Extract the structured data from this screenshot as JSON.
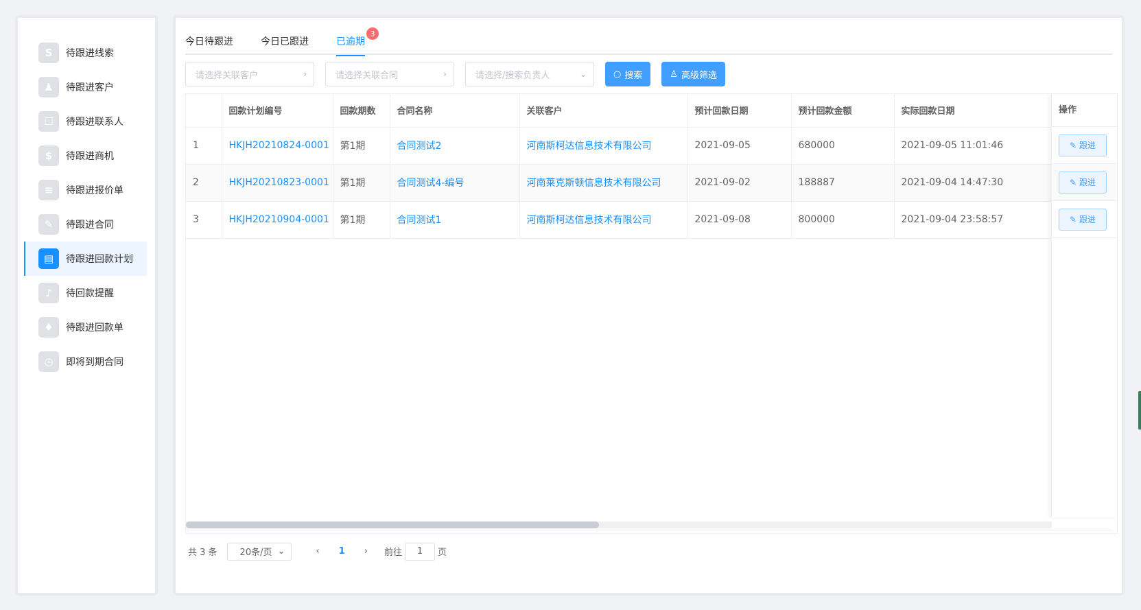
{
  "sidebar": {
    "items": [
      {
        "label": "待跟进线索",
        "icon": "link-icon",
        "glyph": "S"
      },
      {
        "label": "待跟进客户",
        "icon": "users-icon",
        "glyph": "♟"
      },
      {
        "label": "待跟进联系人",
        "icon": "contact-icon",
        "glyph": "☐"
      },
      {
        "label": "待跟进商机",
        "icon": "dollar-icon",
        "glyph": "$"
      },
      {
        "label": "待跟进报价单",
        "icon": "quote-icon",
        "glyph": "≡"
      },
      {
        "label": "待跟进合同",
        "icon": "contract-icon",
        "glyph": "✎"
      },
      {
        "label": "待跟进回款计划",
        "icon": "payment-plan-icon",
        "glyph": "▤",
        "active": true
      },
      {
        "label": "待回款提醒",
        "icon": "bell-icon",
        "glyph": "♪"
      },
      {
        "label": "待跟进回款单",
        "icon": "money-bag-icon",
        "glyph": "♦"
      },
      {
        "label": "即将到期合同",
        "icon": "clock-icon",
        "glyph": "◷"
      }
    ]
  },
  "tabs": [
    {
      "label": "今日待跟进"
    },
    {
      "label": "今日已跟进"
    },
    {
      "label": "已逾期",
      "badge": "3",
      "active": true
    }
  ],
  "filters": {
    "customer_placeholder": "请选择关联客户",
    "contract_placeholder": "请选择关联合同",
    "owner_placeholder": "请选择/搜索负责人",
    "search_label": "搜索",
    "advanced_label": "高级筛选"
  },
  "table": {
    "columns": [
      "",
      "回款计划编号",
      "回款期数",
      "合同名称",
      "关联客户",
      "预计回款日期",
      "预计回款金额",
      "实际回款日期"
    ],
    "action_header": "操作",
    "action_label": "跟进",
    "rows": [
      {
        "index": "1",
        "plan_no": "HKJH20210824-0001",
        "period": "第1期",
        "contract": "合同测试2",
        "customer": "河南斯柯达信息技术有限公司",
        "expected_date": "2021-09-05",
        "amount": "680000",
        "actual_date": "2021-09-05 11:01:46"
      },
      {
        "index": "2",
        "plan_no": "HKJH20210823-0001",
        "period": "第1期",
        "contract": "合同测试4-编号",
        "customer": "河南莱克斯顿信息技术有限公司",
        "expected_date": "2021-09-02",
        "amount": "188887",
        "actual_date": "2021-09-04 14:47:30"
      },
      {
        "index": "3",
        "plan_no": "HKJH20210904-0001",
        "period": "第1期",
        "contract": "合同测试1",
        "customer": "河南斯柯达信息技术有限公司",
        "expected_date": "2021-09-08",
        "amount": "800000",
        "actual_date": "2021-09-04 23:58:57"
      }
    ]
  },
  "pagination": {
    "total": "共 3 条",
    "page_size": "20条/页",
    "current": "1",
    "goto_label": "前往",
    "goto_value": "1",
    "page_suffix": "页"
  }
}
